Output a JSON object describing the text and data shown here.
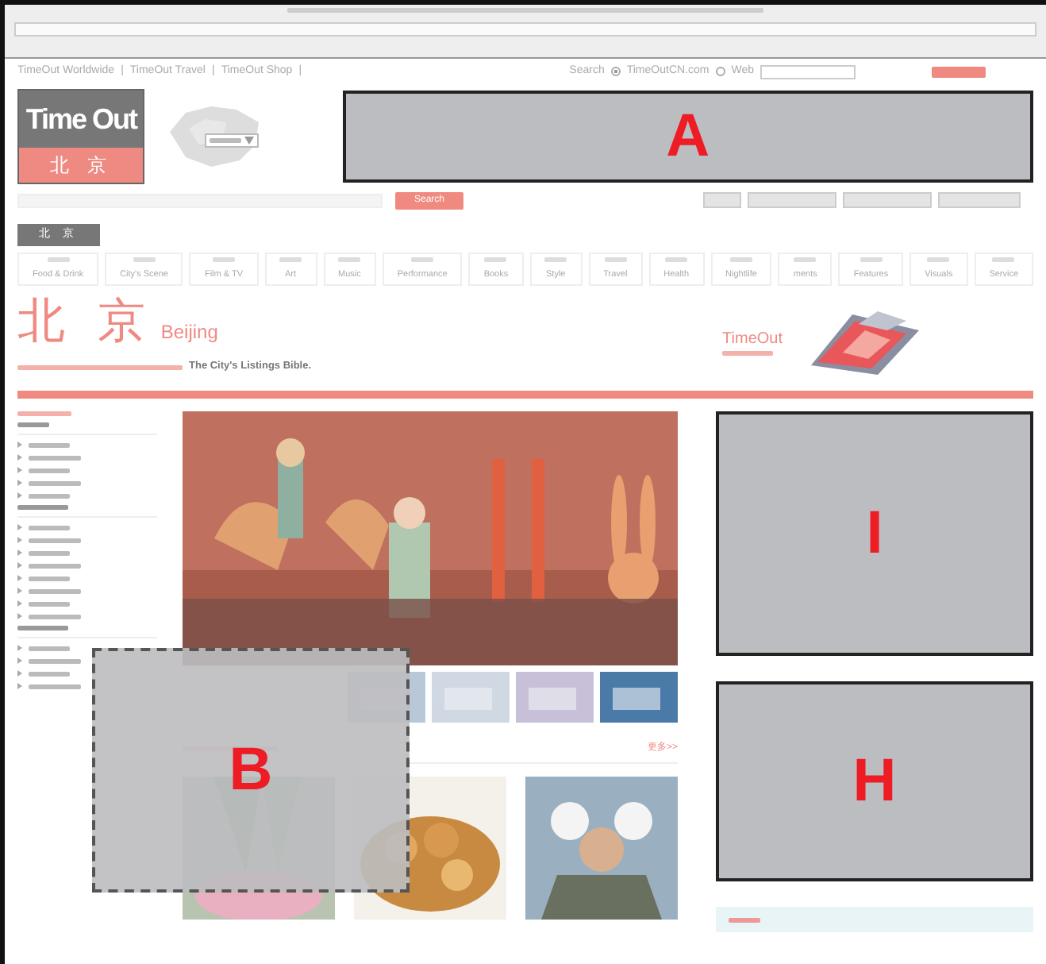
{
  "top_links": [
    "TimeOut Worldwide",
    "TimeOut Travel",
    "TimeOut Shop"
  ],
  "top_link_separator": "|",
  "site_search": {
    "label": "Search",
    "options": [
      {
        "label": "TimeOutCN.com",
        "selected": true
      },
      {
        "label": "Web",
        "selected": false
      }
    ]
  },
  "logo": {
    "wordmark": "Time Out",
    "city": "北 京"
  },
  "search_button": "Search",
  "city_tab": "北 京",
  "nav": [
    {
      "label": "Food & Drink"
    },
    {
      "label": "City's Scene"
    },
    {
      "label": "Film & TV"
    },
    {
      "label": "Art"
    },
    {
      "label": "Music"
    },
    {
      "label": "Performance"
    },
    {
      "label": "Books"
    },
    {
      "label": "Style"
    },
    {
      "label": "Travel"
    },
    {
      "label": "Health"
    },
    {
      "label": "Nightlife"
    },
    {
      "label": "ments"
    },
    {
      "label": "Features"
    },
    {
      "label": "Visuals"
    },
    {
      "label": "Service"
    }
  ],
  "banner": {
    "city": "北 京",
    "city_en": "Beijing",
    "tagline": "The City's Listings Bible.",
    "ad_title": "TimeOut"
  },
  "feature_section": {
    "more": "更多>>"
  },
  "annotations": [
    {
      "label": "A",
      "kind": "solid"
    },
    {
      "label": "B",
      "kind": "dashed"
    },
    {
      "label": "I",
      "kind": "solid"
    },
    {
      "label": "H",
      "kind": "solid"
    }
  ]
}
